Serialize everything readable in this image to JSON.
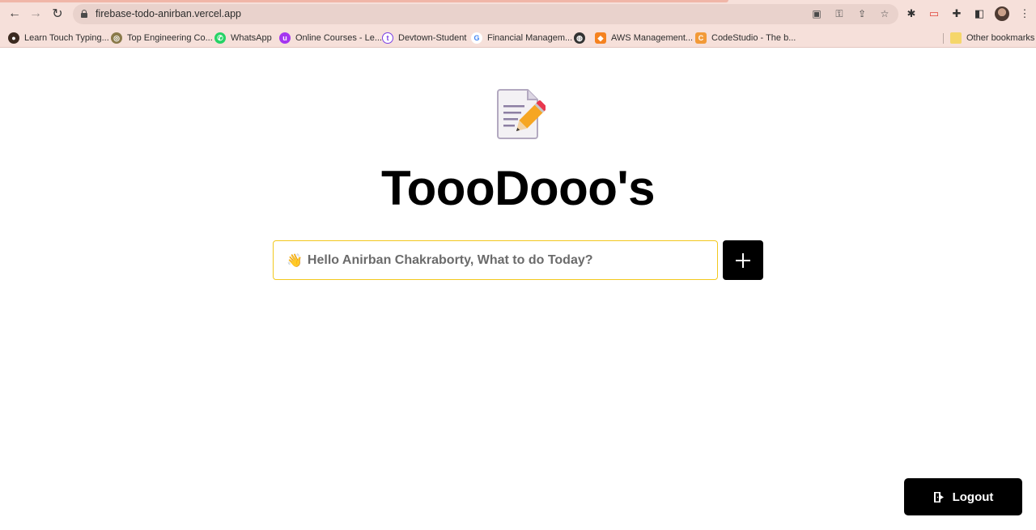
{
  "browser": {
    "url": "firebase-todo-anirban.vercel.app",
    "bookmarks": [
      {
        "label": "Learn Touch Typing...",
        "icon": "typing-icon",
        "color": "#3b2a20"
      },
      {
        "label": "Top Engineering Co...",
        "icon": "college-icon",
        "color": "#8a7a4a"
      },
      {
        "label": "WhatsApp",
        "icon": "whatsapp-icon",
        "color": "#25d366"
      },
      {
        "label": "Online Courses - Le...",
        "icon": "udemy-icon",
        "color": "#a435f0"
      },
      {
        "label": "Devtown-Student",
        "icon": "devtown-icon",
        "color": "#7b3fe4"
      },
      {
        "label": "Financial Managem...",
        "icon": "google-icon",
        "color": "#4285f4"
      },
      {
        "label": "",
        "icon": "globe-icon",
        "color": "#333333"
      },
      {
        "label": "AWS Management...",
        "icon": "aws-icon",
        "color": "#f58220"
      },
      {
        "label": "CodeStudio - The b...",
        "icon": "codestudio-icon",
        "color": "#f29a38"
      }
    ],
    "other_bookmarks": "Other bookmarks"
  },
  "app": {
    "title": "ToooDooo's",
    "input_placeholder": "Hello Anirban Chakraborty, What to do Today?",
    "input_emoji": "👋",
    "logout_label": "Logout",
    "accent_color": "#f2c81e"
  }
}
